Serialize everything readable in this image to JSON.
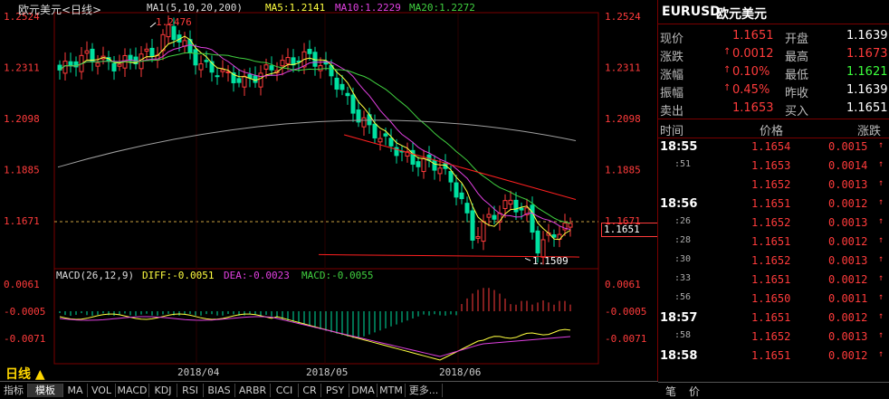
{
  "chart": {
    "title": "欧元美元<日线>",
    "ma_label": "MA1(5,10,20,200)",
    "ma5": "MA5:1.2141",
    "ma10": "MA10:1.2229",
    "ma20": "MA20:1.2272",
    "price_axis": [
      "1.2524",
      "1.2311",
      "1.2098",
      "1.1885",
      "1.1671"
    ],
    "current_price_tag": "1.1651",
    "high_annotation": "1.2476",
    "low_annotation": "1.1509",
    "macd_label": "MACD(26,12,9)",
    "diff": "DIFF:-0.0051",
    "dea": "DEA:-0.0023",
    "macd": "MACD:-0.0055",
    "macd_axis": [
      "0.0061",
      "-0.0005",
      "-0.0071"
    ],
    "dates": [
      "2018/04",
      "2018/05",
      "2018/06"
    ],
    "period": "日线 ▲",
    "colors": {
      "up": "#ff3b3b",
      "down": "#00e0a0",
      "ma5": "#ffff40",
      "ma10": "#e040e0",
      "ma20": "#40d040",
      "ma200": "#a0a0a0"
    }
  },
  "tabs": [
    "指标",
    "模板",
    "MA",
    "VOL",
    "MACD",
    "KDJ",
    "RSI",
    "BIAS",
    "ARBR",
    "CCI",
    "CR",
    "PSY",
    "DMA",
    "MTM",
    "更多..."
  ],
  "quote": {
    "symbol": "EURUSD",
    "name": "欧元美元",
    "rows": [
      {
        "l1": "现价",
        "v1": "1.1651",
        "l2": "开盘",
        "v2": "1.1639"
      },
      {
        "l1": "涨跌",
        "v1": "0.0012",
        "l2": "最高",
        "v2": "1.1673"
      },
      {
        "l1": "涨幅",
        "v1": "0.10%",
        "l2": "最低",
        "v2": "1.1621"
      },
      {
        "l1": "振幅",
        "v1": "0.45%",
        "l2": "昨收",
        "v2": "1.1639"
      },
      {
        "l1": "卖出",
        "v1": "1.1653",
        "l2": "买入",
        "v2": "1.1651"
      }
    ]
  },
  "ticks_header": {
    "time": "时间",
    "price": "价格",
    "change": "涨跌"
  },
  "ticks": [
    {
      "time": "18:55",
      "price": "1.1654",
      "change": "0.0015"
    },
    {
      "time": ":51",
      "price": "1.1653",
      "change": "0.0014"
    },
    {
      "time": "",
      "price": "1.1652",
      "change": "0.0013"
    },
    {
      "time": "18:56",
      "price": "1.1651",
      "change": "0.0012"
    },
    {
      "time": ":26",
      "price": "1.1652",
      "change": "0.0013"
    },
    {
      "time": ":28",
      "price": "1.1651",
      "change": "0.0012"
    },
    {
      "time": ":30",
      "price": "1.1652",
      "change": "0.0013"
    },
    {
      "time": ":33",
      "price": "1.1651",
      "change": "0.0012"
    },
    {
      "time": ":56",
      "price": "1.1650",
      "change": "0.0011"
    },
    {
      "time": "18:57",
      "price": "1.1651",
      "change": "0.0012"
    },
    {
      "time": ":58",
      "price": "1.1652",
      "change": "0.0013"
    },
    {
      "time": "18:58",
      "price": "1.1651",
      "change": "0.0012"
    }
  ],
  "footer": {
    "a": "笔",
    "b": "价"
  }
}
